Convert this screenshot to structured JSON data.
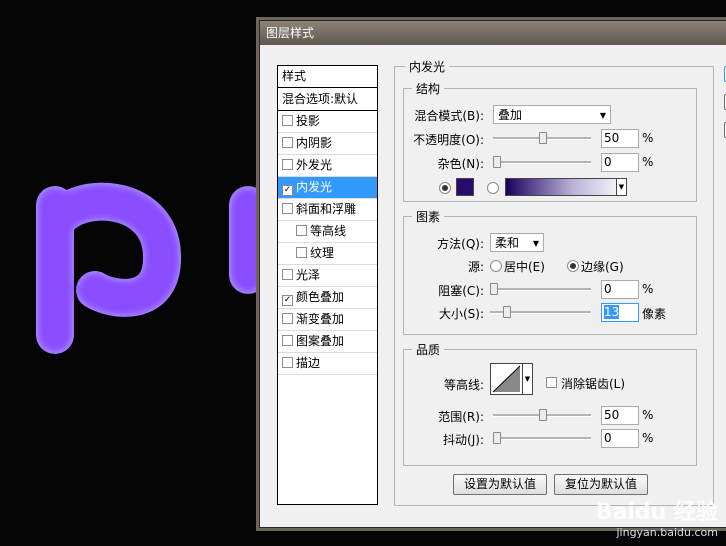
{
  "window": {
    "title": "图层样式"
  },
  "styles": {
    "header": "样式",
    "items": [
      {
        "label": "混合选项:默认",
        "checkbox": false,
        "checked": false,
        "sub": false,
        "selected": false
      },
      {
        "label": "投影",
        "checkbox": true,
        "checked": false,
        "sub": false,
        "selected": false
      },
      {
        "label": "内阴影",
        "checkbox": true,
        "checked": false,
        "sub": false,
        "selected": false
      },
      {
        "label": "外发光",
        "checkbox": true,
        "checked": false,
        "sub": false,
        "selected": false
      },
      {
        "label": "内发光",
        "checkbox": true,
        "checked": true,
        "sub": false,
        "selected": true
      },
      {
        "label": "斜面和浮雕",
        "checkbox": true,
        "checked": false,
        "sub": false,
        "selected": false
      },
      {
        "label": "等高线",
        "checkbox": true,
        "checked": false,
        "sub": true,
        "selected": false
      },
      {
        "label": "纹理",
        "checkbox": true,
        "checked": false,
        "sub": true,
        "selected": false
      },
      {
        "label": "光泽",
        "checkbox": true,
        "checked": false,
        "sub": false,
        "selected": false
      },
      {
        "label": "颜色叠加",
        "checkbox": true,
        "checked": true,
        "sub": false,
        "selected": false
      },
      {
        "label": "渐变叠加",
        "checkbox": true,
        "checked": false,
        "sub": false,
        "selected": false
      },
      {
        "label": "图案叠加",
        "checkbox": true,
        "checked": false,
        "sub": false,
        "selected": false
      },
      {
        "label": "描边",
        "checkbox": true,
        "checked": false,
        "sub": false,
        "selected": false
      }
    ]
  },
  "panel": {
    "title": "内发光",
    "structure": {
      "title": "结构",
      "blend_mode_label": "混合模式(B):",
      "blend_mode_value": "叠加",
      "opacity_label": "不透明度(O):",
      "opacity_value": "50",
      "opacity_percent": 50,
      "noise_label": "杂色(N):",
      "noise_value": "0",
      "noise_percent": 0,
      "unit_percent": "%",
      "color_swatch": "#2a0a6e",
      "color_radio_selected": true
    },
    "elements": {
      "title": "图素",
      "technique_label": "方法(Q):",
      "technique_value": "柔和",
      "source_label": "源:",
      "source_center": "居中(E)",
      "source_edge": "边缘(G)",
      "source_selected": "edge",
      "choke_label": "阻塞(C):",
      "choke_value": "0",
      "choke_percent": 0,
      "size_label": "大小(S):",
      "size_value": "13",
      "size_unit": "像素",
      "unit_percent": "%"
    },
    "quality": {
      "title": "品质",
      "contour_label": "等高线:",
      "antialias_label": "消除锯齿(L)",
      "antialias_checked": false,
      "range_label": "范围(R):",
      "range_value": "50",
      "range_percent": 50,
      "jitter_label": "抖动(J):",
      "jitter_value": "0",
      "jitter_percent": 0,
      "unit_percent": "%"
    },
    "buttons": {
      "make_default": "设置为默认值",
      "reset_default": "复位为默认值"
    }
  },
  "canvas": {
    "text": "pu",
    "text_color": "#8a4dff"
  },
  "watermark": {
    "brand": "Baidu 经验",
    "url": "jingyan.baidu.com"
  }
}
